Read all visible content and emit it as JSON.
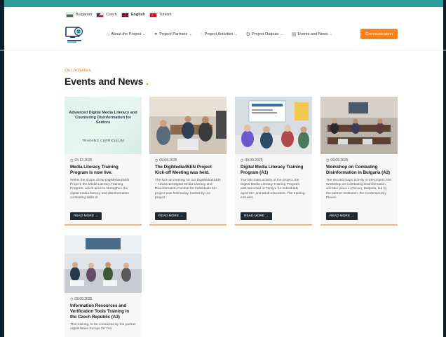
{
  "languages": [
    {
      "code": "bg",
      "label": "Bulgarian"
    },
    {
      "code": "cz",
      "label": "Czech"
    },
    {
      "code": "en",
      "label": "English"
    },
    {
      "code": "tr",
      "label": "Turkish"
    }
  ],
  "nav": {
    "items": [
      {
        "label": "About the Project",
        "icon": "home-icon"
      },
      {
        "label": "Project Partners",
        "icon": "handshake-icon"
      },
      {
        "label": "Project Activities",
        "icon": "activity-icon"
      },
      {
        "label": "Project Outputs",
        "icon": "gear-icon"
      },
      {
        "label": "Events and News",
        "icon": "document-icon"
      }
    ],
    "cta": "Communication"
  },
  "section": {
    "subtitle": "Our Activities",
    "title": "Events and News"
  },
  "cards": [
    {
      "date": "23.12.2025",
      "title": "Media Literacy Training Program is now live.",
      "text": "Within the scope of the DigiMedia4SEN Project, the Media Literacy Training Program, which aims to strengthen the digital media literacy and disinformation combating skills of",
      "button": "READ MORE →",
      "image": {
        "title": "Advanced Digital Media Literacy and Countering Disinformation for Seniors",
        "subtitle": "TRAINING CURRICULUM"
      }
    },
    {
      "date": "09.09.2025",
      "title": "The DigiMedia4SEN Project Kick-off Meeting was held.",
      "text": "The kick-off meeting for our DigiMedia4SEN – Advanced Digital Media Literacy and Disinformation Combat for Individuals 50+ project was held today, hosted by our project",
      "button": "READ MORE →"
    },
    {
      "date": "09.09.2025",
      "title": "Digital Media Literacy Training Program (A1)",
      "text": "The first main activity of the project, the Digital Media Literacy Training Program, was launched in Türkiye for individuals aged 50+ and adult educators. The training includes",
      "button": "READ MORE →"
    },
    {
      "date": "09.09.2025",
      "title": "Workshop on Combating Disinformation in Bulgaria (A2)",
      "text": "The second major activity of the project, the Workshop on Combating Disinformation, will take place in Pleven, Bulgaria, led by the partner institution, the Contemporary Pleven",
      "button": "READ MORE →"
    },
    {
      "date": "09.09.2025",
      "title": "Information Resources and Verification Tools Training in the Czech Republic (A3)",
      "text": "This training, to be conducted by the partner organization Europe for You",
      "button": "READ MORE →"
    }
  ],
  "colors": {
    "accent": "#f58220",
    "teal": "#2a9d9a",
    "dark": "#1d2a36"
  }
}
